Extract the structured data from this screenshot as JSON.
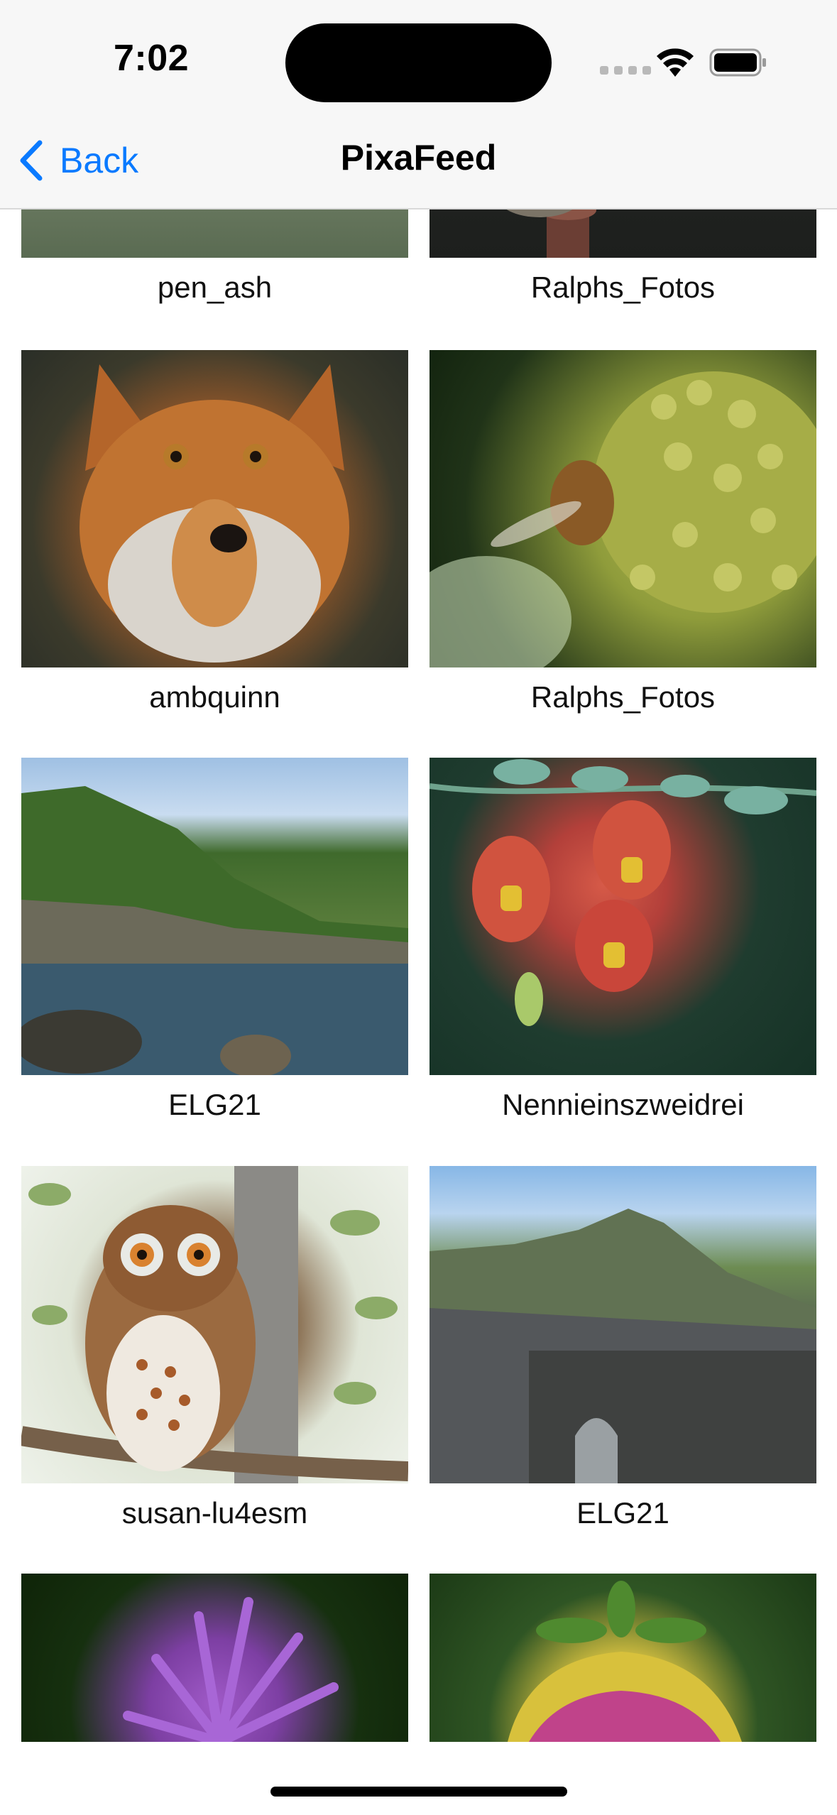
{
  "status_bar": {
    "time": "7:02"
  },
  "nav": {
    "back_label": "Back",
    "title": "PixaFeed"
  },
  "feed": {
    "items": [
      {
        "author": "pen_ash",
        "image": "blurred-landscape-photo"
      },
      {
        "author": "Ralphs_Fotos",
        "image": "bird-on-post-photo"
      },
      {
        "author": "ambquinn",
        "image": "red-fox-photo"
      },
      {
        "author": "Ralphs_Fotos",
        "image": "bee-on-ivy-flowers-photo"
      },
      {
        "author": "ELG21",
        "image": "rocky-coastline-photo"
      },
      {
        "author": "Nennieinszweidrei",
        "image": "red-flower-buds-photo"
      },
      {
        "author": "susan-lu4esm",
        "image": "owl-illustration"
      },
      {
        "author": "ELG21",
        "image": "stone-bridge-island-photo"
      },
      {
        "author": "",
        "image": "purple-thistle-photo"
      },
      {
        "author": "",
        "image": "dahlia-bud-photo"
      }
    ]
  },
  "colors": {
    "accent": "#0a7aff",
    "nav_background": "#f7f7f7"
  }
}
